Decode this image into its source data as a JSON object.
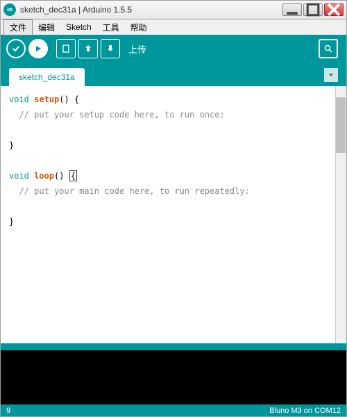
{
  "titlebar": {
    "text": "sketch_dec31a | Arduino 1.5.5"
  },
  "menubar": {
    "items": [
      "文件",
      "编辑",
      "Sketch",
      "工具",
      "帮助"
    ]
  },
  "toolbar": {
    "upload_label": "上传"
  },
  "tabs": {
    "active": "sketch_dec31a"
  },
  "editor": {
    "line1_kw": "void",
    "line1_func": "setup",
    "line1_rest": "() {",
    "line2_comment": "// put your setup code here, to run once:",
    "line3": "}",
    "line5_kw": "void",
    "line5_func": "loop",
    "line5_rest1": "() ",
    "line5_brace": "{",
    "line6_comment": "// put your main code here, to run repeatedly:",
    "line8": "}"
  },
  "statusbar": {
    "line": "9",
    "board": "Bluno M3 on COM12"
  }
}
